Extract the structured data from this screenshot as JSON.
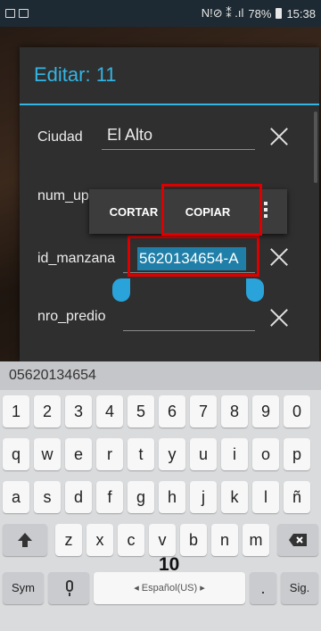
{
  "status_bar": {
    "signal_text": "N!⊘ ⁑ .ıl",
    "battery": "78%",
    "time": "15:38"
  },
  "dialog": {
    "title": "Editar: 11",
    "fields": [
      {
        "label": "Ciudad",
        "value": "El Alto"
      },
      {
        "label": "num_up",
        "value": ""
      },
      {
        "label": "id_manzana",
        "value": "5620134654-A"
      },
      {
        "label": "nro_predio",
        "value": ""
      }
    ]
  },
  "context_menu": {
    "cut_label": "CORTAR",
    "copy_label": "COPIAR"
  },
  "keyboard": {
    "suggestion": "05620134654",
    "rows": [
      [
        "1",
        "2",
        "3",
        "4",
        "5",
        "6",
        "7",
        "8",
        "9",
        "0"
      ],
      [
        "q",
        "w",
        "e",
        "r",
        "t",
        "y",
        "u",
        "i",
        "o",
        "p"
      ],
      [
        "a",
        "s",
        "d",
        "f",
        "g",
        "h",
        "j",
        "k",
        "l",
        "ñ"
      ],
      [
        "z",
        "x",
        "c",
        "v",
        "b",
        "n",
        "m"
      ]
    ],
    "sym_label": "Sym",
    "space_label": "◂ Español(US) ▸",
    "period_label": ".",
    "next_label": "Sig."
  },
  "page_number": "10",
  "colors": {
    "accent": "#33b5e5",
    "selection": "#1f7fa8",
    "highlight_box": "#dd0000"
  }
}
